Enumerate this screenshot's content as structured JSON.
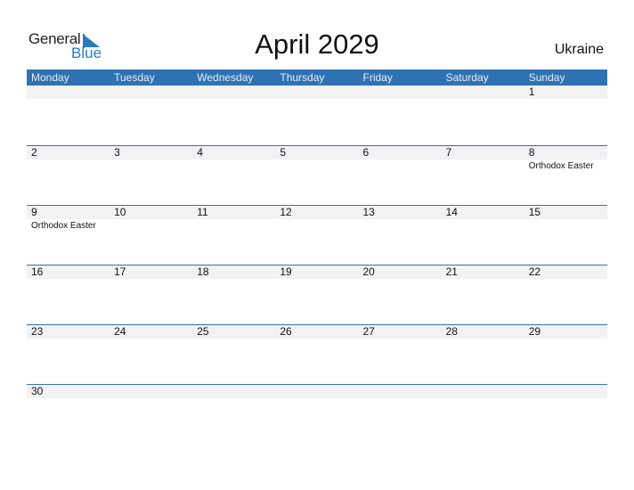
{
  "logo": {
    "line1": "General",
    "line2": "Blue"
  },
  "title": "April 2029",
  "country": "Ukraine",
  "colors": {
    "header": "#2f72b3",
    "band": "#f2f2f2",
    "brand": "#2a7ac0"
  },
  "weekdays": [
    "Monday",
    "Tuesday",
    "Wednesday",
    "Thursday",
    "Friday",
    "Saturday",
    "Sunday"
  ],
  "weeks": [
    [
      {
        "day": ""
      },
      {
        "day": ""
      },
      {
        "day": ""
      },
      {
        "day": ""
      },
      {
        "day": ""
      },
      {
        "day": ""
      },
      {
        "day": "1"
      }
    ],
    [
      {
        "day": "2"
      },
      {
        "day": "3"
      },
      {
        "day": "4"
      },
      {
        "day": "5"
      },
      {
        "day": "6"
      },
      {
        "day": "7"
      },
      {
        "day": "8",
        "event": "Orthodox Easter"
      }
    ],
    [
      {
        "day": "9",
        "event": "Orthodox Easter"
      },
      {
        "day": "10"
      },
      {
        "day": "11"
      },
      {
        "day": "12"
      },
      {
        "day": "13"
      },
      {
        "day": "14"
      },
      {
        "day": "15"
      }
    ],
    [
      {
        "day": "16"
      },
      {
        "day": "17"
      },
      {
        "day": "18"
      },
      {
        "day": "19"
      },
      {
        "day": "20"
      },
      {
        "day": "21"
      },
      {
        "day": "22"
      }
    ],
    [
      {
        "day": "23"
      },
      {
        "day": "24"
      },
      {
        "day": "25"
      },
      {
        "day": "26"
      },
      {
        "day": "27"
      },
      {
        "day": "28"
      },
      {
        "day": "29"
      }
    ],
    [
      {
        "day": "30"
      },
      {
        "day": ""
      },
      {
        "day": ""
      },
      {
        "day": ""
      },
      {
        "day": ""
      },
      {
        "day": ""
      },
      {
        "day": ""
      }
    ]
  ]
}
